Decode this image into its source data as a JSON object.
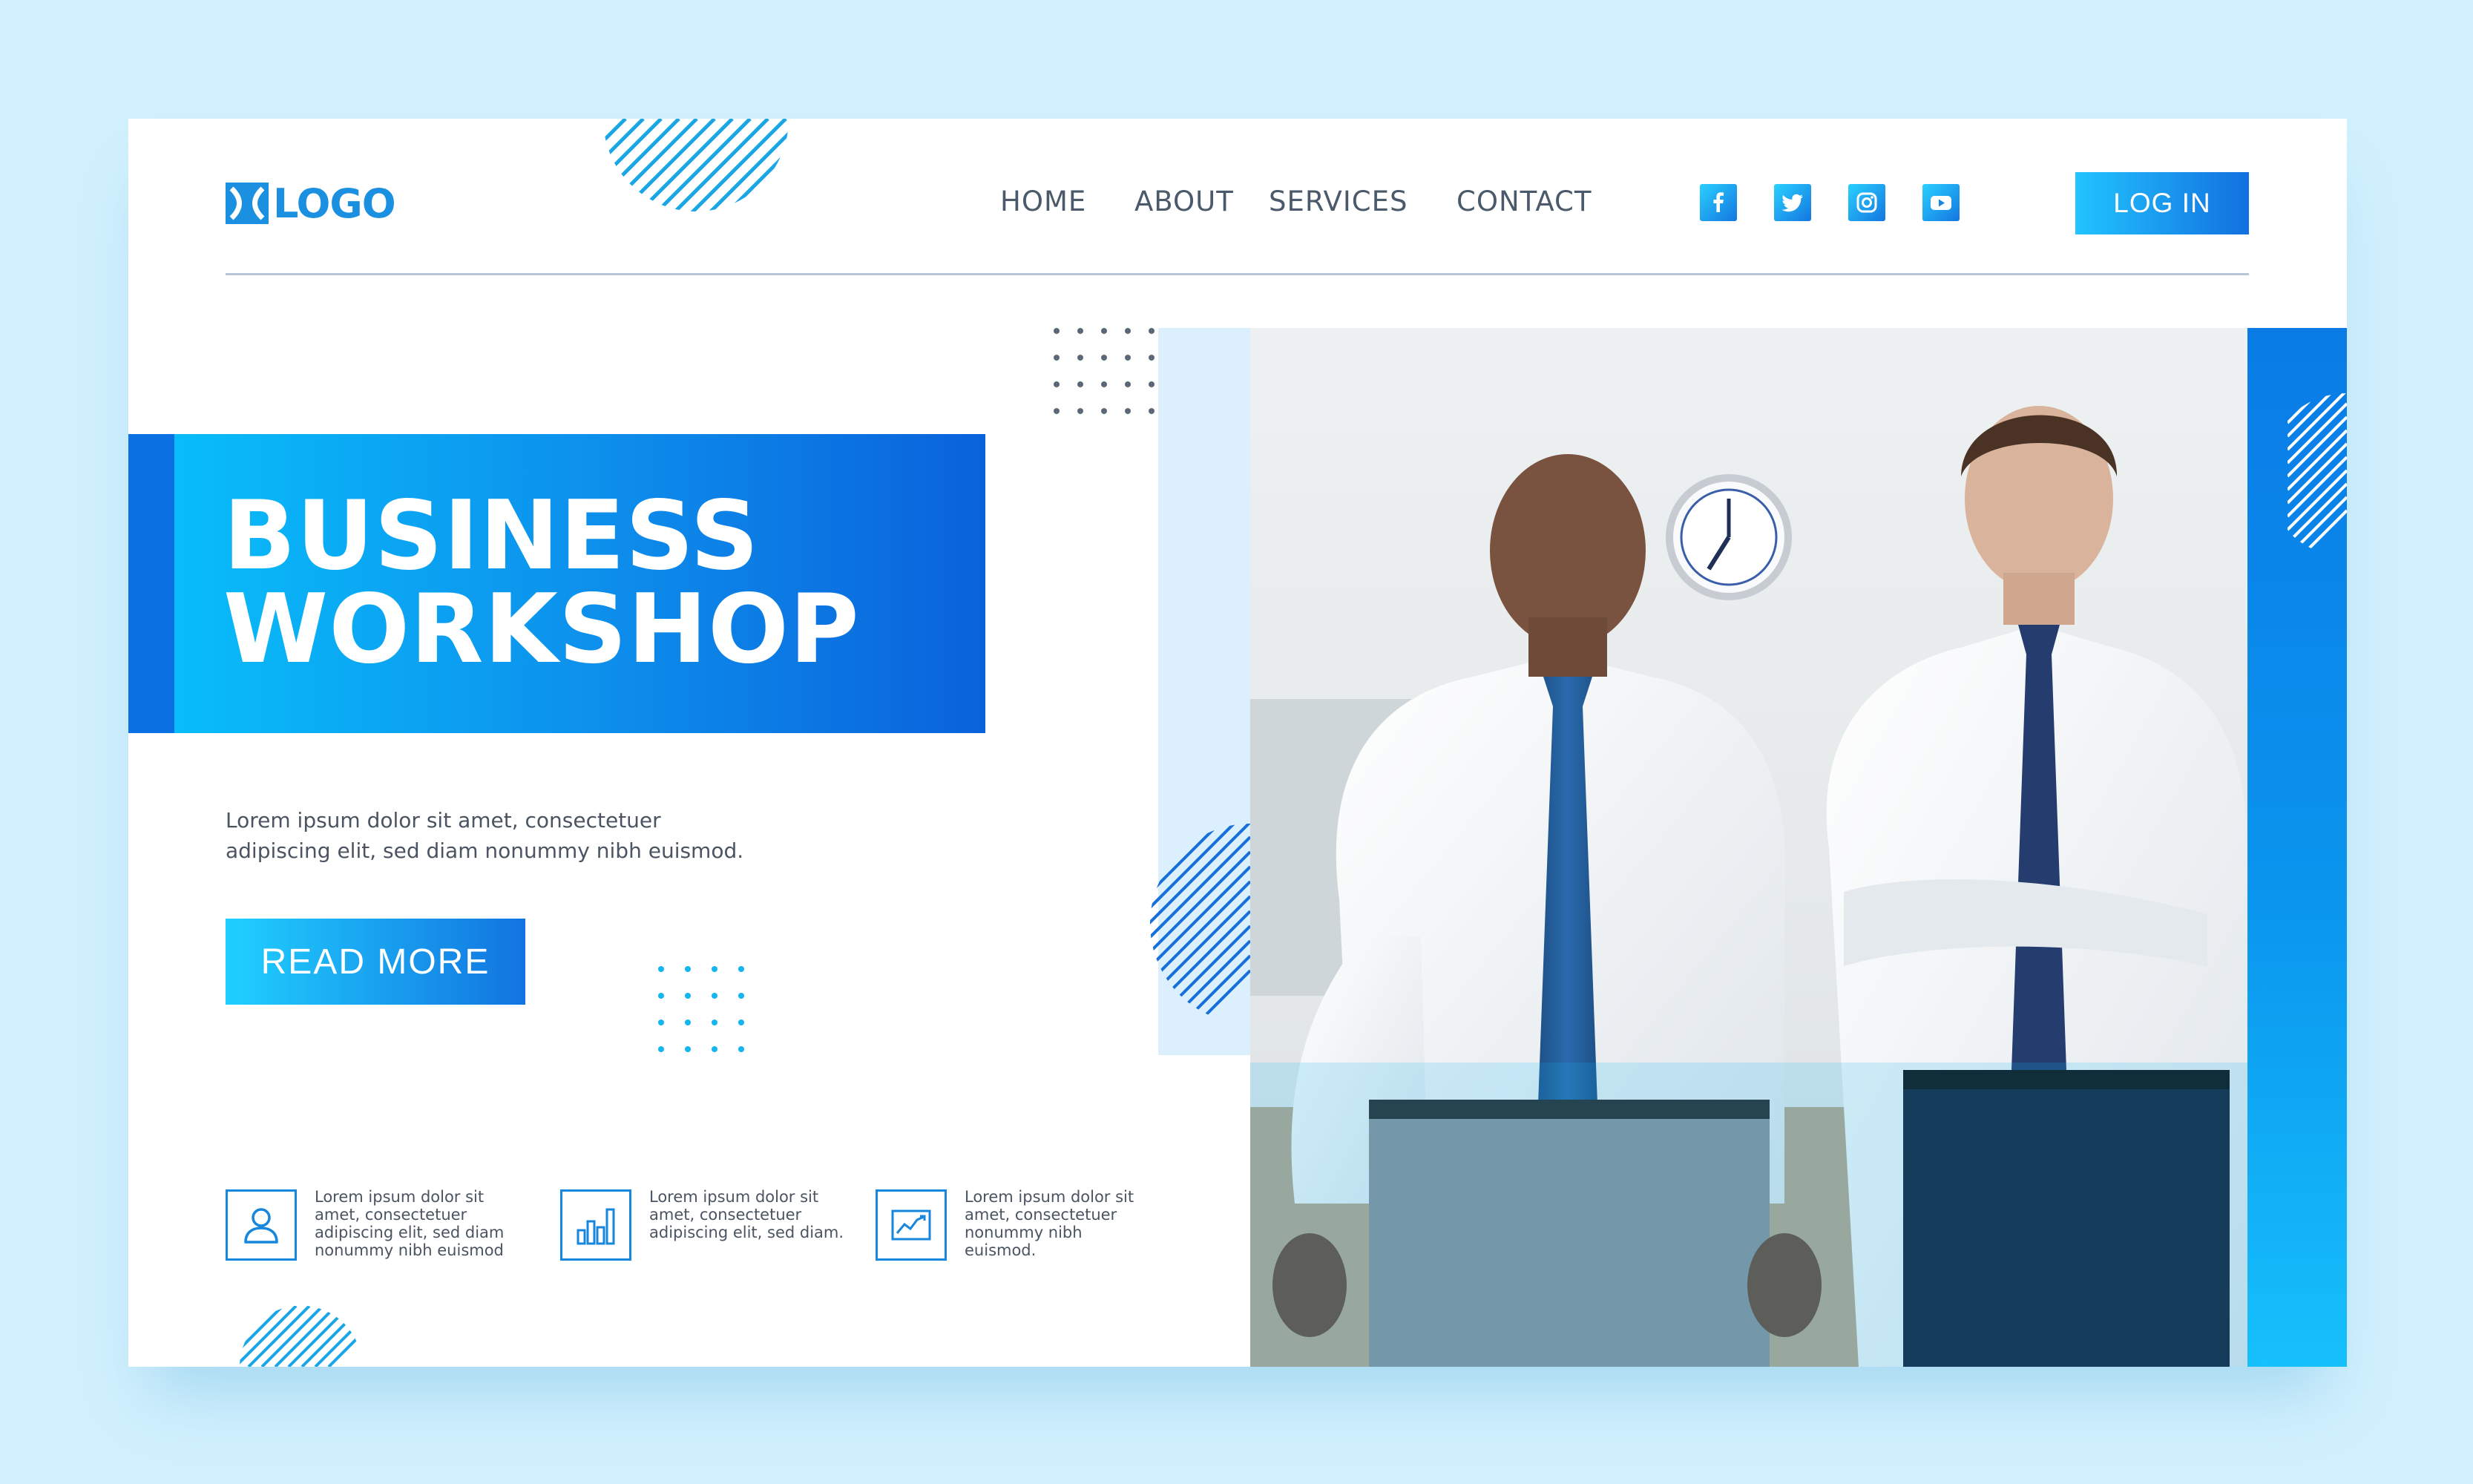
{
  "header": {
    "logo_text": "LOGO",
    "nav": [
      {
        "label": "HOME"
      },
      {
        "label": "ABOUT"
      },
      {
        "label": "SERVICES"
      },
      {
        "label": "CONTACT"
      }
    ],
    "social": [
      {
        "icon": "facebook-icon"
      },
      {
        "icon": "twitter-icon"
      },
      {
        "icon": "instagram-icon"
      },
      {
        "icon": "youtube-icon"
      }
    ],
    "login_label": "LOG IN"
  },
  "hero": {
    "title_line1": "BUSINESS",
    "title_line2": "WORKSHOP",
    "description": "Lorem ipsum dolor sit amet, consectetuer adipiscing elit, sed diam nonummy nibh euismod.",
    "cta_label": "READ MORE",
    "photo_subject": "photo-two-businessmen"
  },
  "features": [
    {
      "icon": "user-icon",
      "text": "Lorem ipsum dolor sit\namet, consectetuer\nadipiscing elit, sed diam\nnonummy nibh euismod"
    },
    {
      "icon": "bar-chart-icon",
      "text": "Lorem ipsum dolor sit\namet, consectetuer\nadipiscing elit, sed diam."
    },
    {
      "icon": "line-chart-icon",
      "text": "Lorem ipsum dolor sit\namet, consectetuer\nnonummy nibh\neuismod."
    }
  ],
  "colors": {
    "page_background": "#d1f0fd",
    "accent_light": "#08c2fb",
    "accent_dark": "#0a62db",
    "text": "#4a5462"
  }
}
